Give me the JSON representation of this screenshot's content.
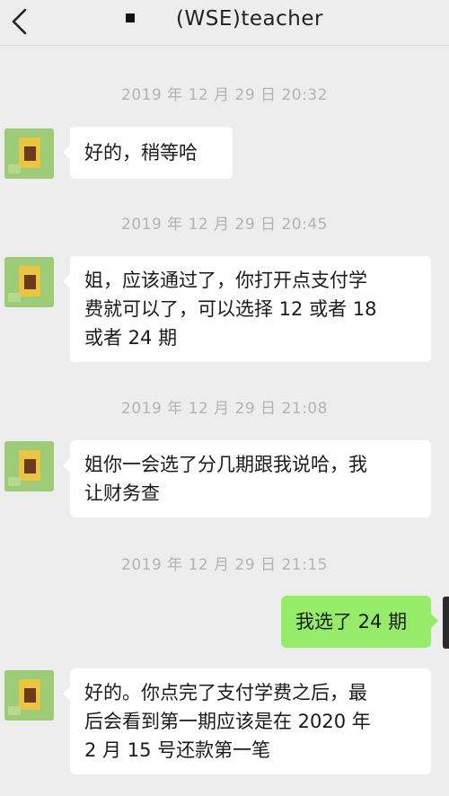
{
  "header": {
    "title": "(WSE)teacher",
    "back_icon": "chevron-left-icon"
  },
  "messages": [
    {
      "type": "timestamp",
      "text": "2019 年 12 月 29 日 20:32"
    },
    {
      "type": "incoming",
      "text": "好的，稍等哈"
    },
    {
      "type": "timestamp",
      "text": "2019 年 12 月 29 日 20:45"
    },
    {
      "type": "incoming",
      "lines": [
        "姐，应该通过了，你打开点支付学",
        "费就可以了，可以选择 12 或者 18",
        "或者 24 期"
      ]
    },
    {
      "type": "timestamp",
      "text": "2019 年 12 月 29 日 21:08"
    },
    {
      "type": "incoming",
      "lines": [
        "姐你一会选了分几期跟我说哈，我",
        "让财务查"
      ]
    },
    {
      "type": "timestamp",
      "text": "2019 年 12 月 29 日 21:15"
    },
    {
      "type": "outgoing",
      "text": "我选了 24 期"
    },
    {
      "type": "incoming",
      "lines": [
        "好的。你点完了支付学费之后，最",
        "后会看到第一期应该是在 2020 年",
        "2 月 15 号还款第一笔"
      ]
    }
  ],
  "colors": {
    "background": "#ededed",
    "incoming_bubble": "#ffffff",
    "outgoing_bubble": "#95ec69",
    "timestamp_text": "#b3b3b3"
  }
}
